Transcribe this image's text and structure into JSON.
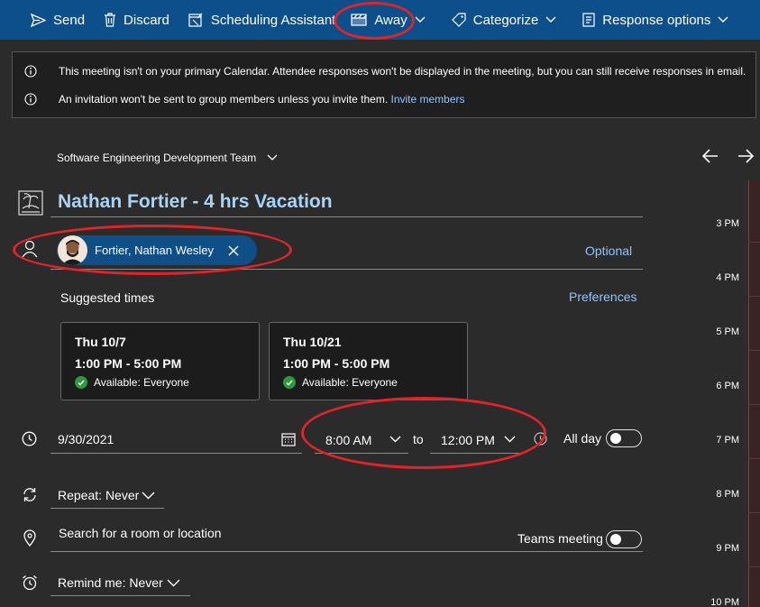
{
  "toolbar": {
    "send": "Send",
    "discard": "Discard",
    "scheduling": "Scheduling Assistant",
    "show_as": "Away",
    "categorize": "Categorize",
    "response": "Response options"
  },
  "banner": {
    "line1": "This meeting isn't on your primary Calendar. Attendee responses won't be displayed in the meeting, but you can still receive responses in email.",
    "line2": "An invitation won't be sent to group members unless you invite them.",
    "line2_link": "Invite members"
  },
  "group": {
    "name": "Software Engineering Development Team"
  },
  "event": {
    "title": "Nathan Fortier - 4 hrs Vacation"
  },
  "attendees": {
    "chip_name": "Fortier, Nathan Wesley",
    "optional": "Optional"
  },
  "suggested": {
    "label": "Suggested times",
    "preferences": "Preferences",
    "slots": [
      {
        "date": "Thu 10/7",
        "time": "1:00 PM - 5:00 PM",
        "availability": "Available: Everyone"
      },
      {
        "date": "Thu 10/21",
        "time": "1:00 PM - 5:00 PM",
        "availability": "Available: Everyone"
      }
    ]
  },
  "datetime": {
    "date": "9/30/2021",
    "start": "8:00 AM",
    "to": "to",
    "end": "12:00 PM",
    "all_day": "All day"
  },
  "repeat": {
    "label": "Repeat:",
    "value": "Never"
  },
  "location": {
    "placeholder": "Search for a room or location",
    "teams": "Teams meeting"
  },
  "remind": {
    "label": "Remind me:",
    "value": "Never"
  },
  "timeline": {
    "hours": [
      "3 PM",
      "4 PM",
      "5 PM",
      "6 PM",
      "7 PM",
      "8 PM",
      "9 PM",
      "10 PM"
    ]
  },
  "colors": {
    "toolbar": "#0d4f8b",
    "accent_link": "#8ec5ff",
    "annotation": "#e0242a",
    "title": "#a9d3f5"
  }
}
